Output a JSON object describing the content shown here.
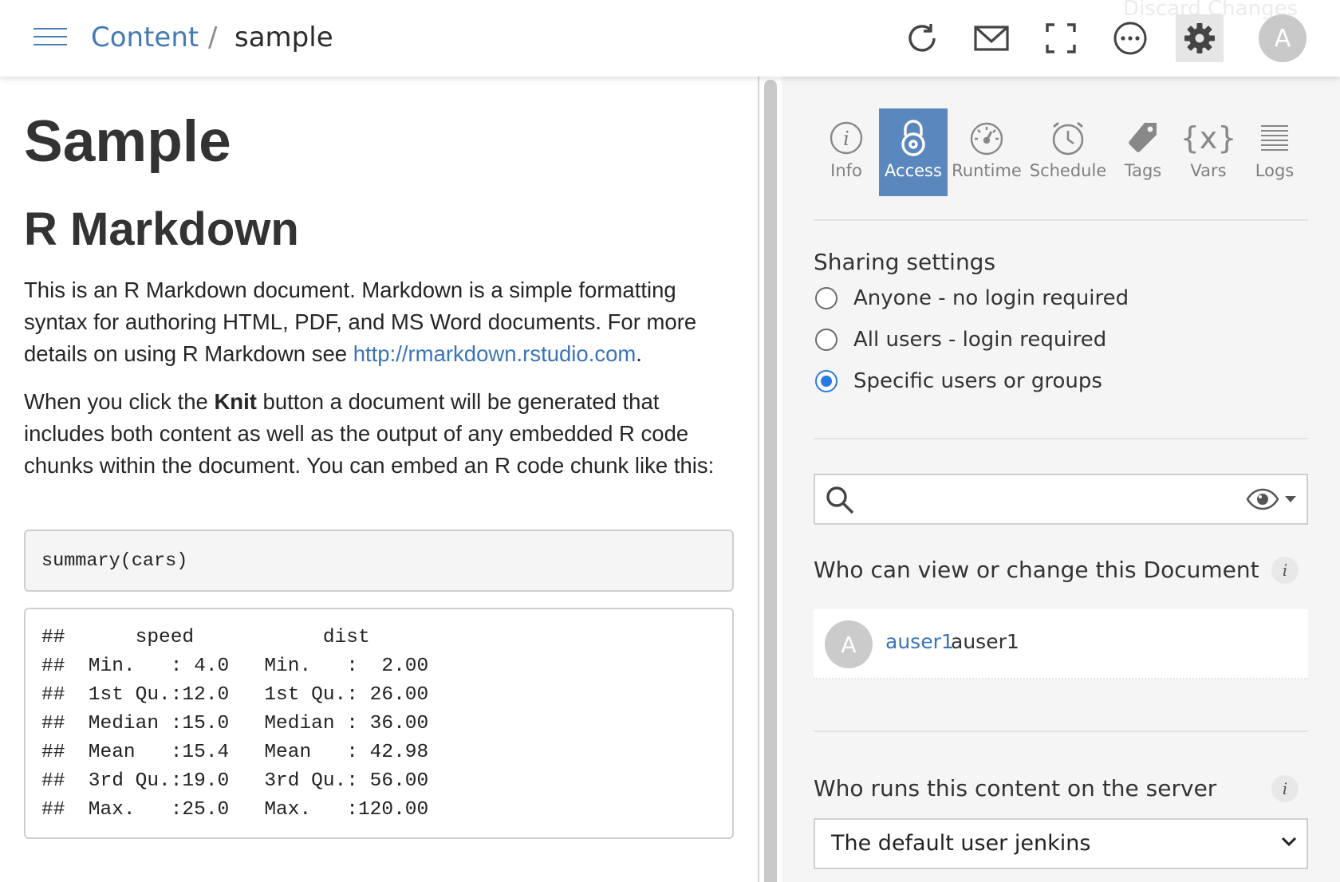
{
  "header": {
    "menu_icon": "hamburger-icon",
    "breadcrumb_root": "Content",
    "breadcrumb_sep": "/",
    "breadcrumb_current": "sample",
    "ghost_text": "Discard Changes",
    "actions": [
      {
        "name": "refresh-icon"
      },
      {
        "name": "mail-icon"
      },
      {
        "name": "fullscreen-icon"
      },
      {
        "name": "more-icon"
      },
      {
        "name": "gear-icon"
      }
    ],
    "avatar_letter": "A"
  },
  "document": {
    "title": "Sample",
    "heading": "R Markdown",
    "para1_text": "This is an R Markdown document. Markdown is a simple formatting syntax for authoring HTML, PDF, and MS Word documents. For more details on using R Markdown see ",
    "para1_link": "http://rmarkdown.rstudio.com",
    "para1_end": ".",
    "para2_pre": "When you click the ",
    "para2_bold": "Knit",
    "para2_post": " button a document will be generated that includes both content as well as the output of any embedded R code chunks within the document. You can embed an R code chunk like this:",
    "code": "summary(cars)",
    "output_lines": [
      "##      speed           dist       ",
      "##  Min.   : 4.0   Min.   :  2.00  ",
      "##  1st Qu.:12.0   1st Qu.: 26.00  ",
      "##  Median :15.0   Median : 36.00  ",
      "##  Mean   :15.4   Mean   : 42.98  ",
      "##  3rd Qu.:19.0   3rd Qu.: 56.00  ",
      "##  Max.   :25.0   Max.   :120.00  "
    ]
  },
  "panel": {
    "tabs": [
      {
        "label": "Info",
        "icon": "info-icon"
      },
      {
        "label": "Access",
        "icon": "lock-icon",
        "active": true
      },
      {
        "label": "Runtime",
        "icon": "gauge-icon"
      },
      {
        "label": "Schedule",
        "icon": "clock-icon"
      },
      {
        "label": "Tags",
        "icon": "tag-icon"
      },
      {
        "label": "Vars",
        "icon": "vars-icon"
      },
      {
        "label": "Logs",
        "icon": "logs-icon"
      }
    ],
    "vars_glyph": "{x}",
    "sharing_title": "Sharing settings",
    "sharing_options": [
      {
        "label": "Anyone - no login required",
        "selected": false
      },
      {
        "label": "All users - login required",
        "selected": false
      },
      {
        "label": "Specific users or groups",
        "selected": true
      }
    ],
    "search_placeholder": "",
    "viewers_title": "Who can view or change this Document",
    "info_glyph": "i",
    "users": [
      {
        "avatar_letter": "A",
        "username": "auser1",
        "display_name": "auser1"
      }
    ],
    "runs_title": "Who runs this content on the server",
    "runas_value": "The default user jenkins"
  },
  "colors": {
    "accent": "#5a87bd",
    "link": "#3a74b8",
    "radio_selected": "#2a7ae2"
  }
}
